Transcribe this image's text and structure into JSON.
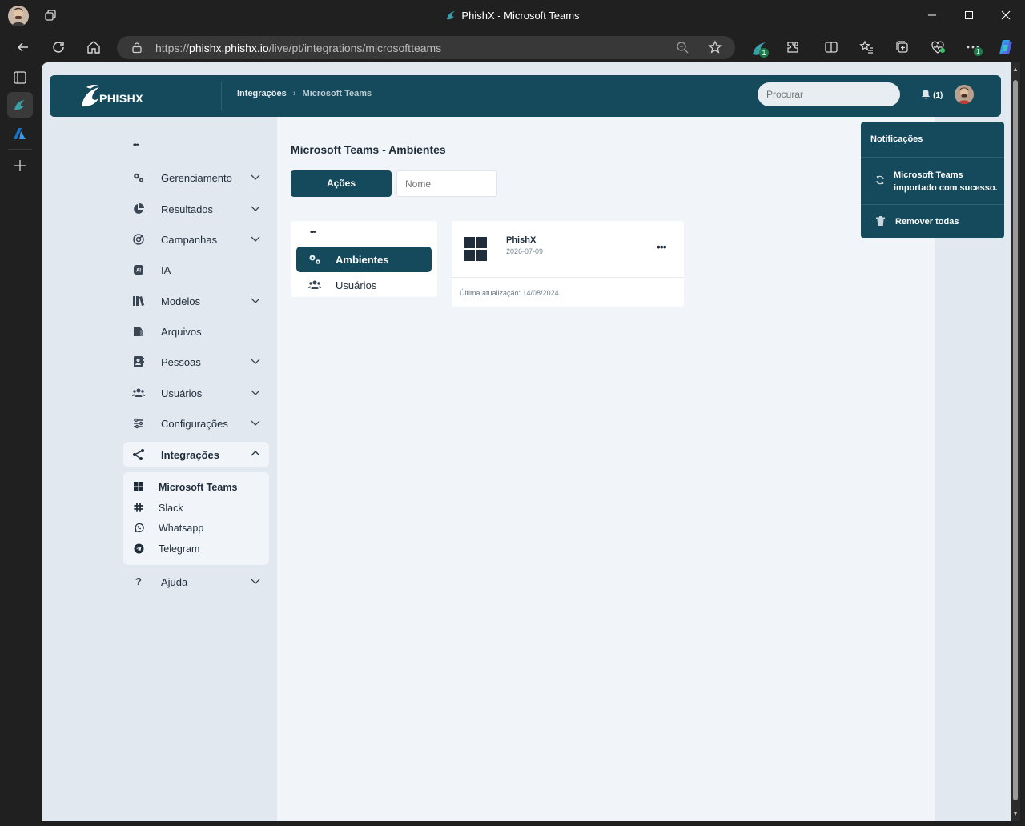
{
  "browser": {
    "window_title": "PhishX - Microsoft Teams",
    "url_prefix": "https://",
    "url_host": "phishx.phishx.io",
    "url_path": "/live/pt/integrations/microsoftteams",
    "extension_badge": "1",
    "copilot_badge": "1"
  },
  "header": {
    "logo_text": "PHISHX",
    "breadcrumb_root": "Integrações",
    "breadcrumb_sep": "›",
    "breadcrumb_current": "Microsoft Teams",
    "search_placeholder": "Procurar",
    "notification_count": "(1)"
  },
  "nav": {
    "dots": "•••",
    "items": [
      {
        "label": "Gerenciamento",
        "icon": "gears-icon"
      },
      {
        "label": "Resultados",
        "icon": "pie-chart-icon"
      },
      {
        "label": "Campanhas",
        "icon": "target-icon"
      },
      {
        "label": "IA",
        "icon": "ai-icon"
      },
      {
        "label": "Modelos",
        "icon": "library-icon"
      },
      {
        "label": "Arquivos",
        "icon": "folder-icon"
      },
      {
        "label": "Pessoas",
        "icon": "contact-card-icon"
      },
      {
        "label": "Usuários",
        "icon": "users-icon"
      },
      {
        "label": "Configurações",
        "icon": "sliders-icon"
      },
      {
        "label": "Integrações",
        "icon": "share-nodes-icon"
      },
      {
        "label": "Ajuda",
        "icon": "question-icon"
      }
    ],
    "submenu": [
      {
        "label": "Microsoft Teams",
        "icon": "windows-icon"
      },
      {
        "label": "Slack",
        "icon": "slack-icon"
      },
      {
        "label": "Whatsapp",
        "icon": "whatsapp-icon"
      },
      {
        "label": "Telegram",
        "icon": "telegram-icon"
      }
    ]
  },
  "main": {
    "title": "Microsoft Teams - Ambientes",
    "actions_label": "Ações",
    "name_filter_placeholder": "Nome",
    "panel_dots": "•••",
    "panel_items": [
      {
        "label": "Ambientes",
        "icon": "gears-icon"
      },
      {
        "label": "Usuários",
        "icon": "users-icon"
      }
    ],
    "card": {
      "name": "PhishX",
      "date": "2026-07-09",
      "updated": "Última atualização: 14/08/2024",
      "more": "•••"
    }
  },
  "notifications": {
    "heading": "Notificações",
    "message": "Microsoft Teams importado com sucesso.",
    "clear_all": "Remover todas"
  }
}
